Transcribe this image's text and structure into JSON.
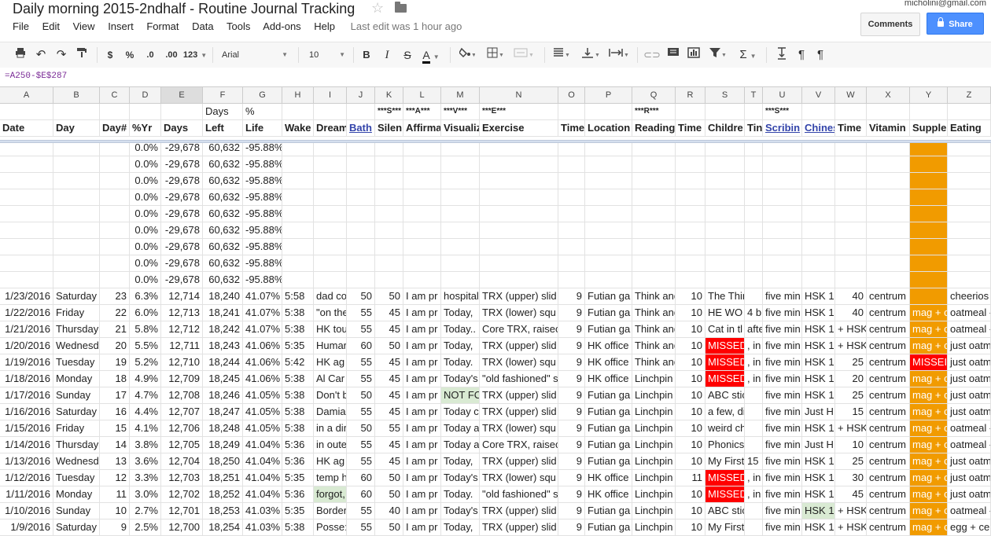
{
  "doc_title": "Daily morning 2015-2ndhalf - Routine Journal Tracking",
  "account_email": "micholini@gmail.com",
  "buttons": {
    "comments": "Comments",
    "share": "Share"
  },
  "menu": [
    "File",
    "Edit",
    "View",
    "Insert",
    "Format",
    "Data",
    "Tools",
    "Add-ons",
    "Help"
  ],
  "last_edit": "Last edit was 1 hour ago",
  "toolbar": {
    "currency": "$",
    "percent": "%",
    "dec_decrease": ".0",
    "dec_increase": ".00",
    "format_more": "123",
    "font": "Arial",
    "font_size": "10",
    "bold": "B",
    "italic": "I",
    "strike": "S",
    "text_color": "A",
    "sum": "Σ"
  },
  "formula": "=A250-$E$287",
  "columns": [
    "A",
    "B",
    "C",
    "D",
    "E",
    "F",
    "G",
    "H",
    "I",
    "J",
    "K",
    "L",
    "M",
    "N",
    "O",
    "P",
    "Q",
    "R",
    "S",
    "T",
    "U",
    "V",
    "W",
    "X",
    "Y",
    "Z"
  ],
  "selected_column": "E",
  "header_row1": {
    "F": "Days",
    "G": "%",
    "K": "***S***",
    "L": "***A***",
    "M": "***V***",
    "N": "***E***",
    "Q": "***R***",
    "U": "***S***"
  },
  "header_row2": {
    "A": "Date",
    "B": "Day",
    "C": "Day#",
    "D": "%Yr",
    "E": "Days",
    "F": "Left",
    "G": "Life",
    "H": "Wake",
    "I": "Dream",
    "J": "Bath",
    "K": "Silen",
    "L": "Affirma",
    "M": "Visualiz",
    "N": "Exercise",
    "O": "Time",
    "P": "Location",
    "Q": "Reading",
    "R": "Time",
    "S": "Childre",
    "T": "Tin",
    "U": "Scribin",
    "V": "Chines",
    "W": "Time",
    "X": "Vitamin",
    "Y": "Supple",
    "Z": "Eating"
  },
  "blank_rows": [
    {
      "D": "0.0%",
      "E": "-29,678",
      "F": "60,632",
      "G": "-95.88%"
    },
    {
      "D": "0.0%",
      "E": "-29,678",
      "F": "60,632",
      "G": "-95.88%"
    },
    {
      "D": "0.0%",
      "E": "-29,678",
      "F": "60,632",
      "G": "-95.88%"
    },
    {
      "D": "0.0%",
      "E": "-29,678",
      "F": "60,632",
      "G": "-95.88%"
    },
    {
      "D": "0.0%",
      "E": "-29,678",
      "F": "60,632",
      "G": "-95.88%"
    },
    {
      "D": "0.0%",
      "E": "-29,678",
      "F": "60,632",
      "G": "-95.88%"
    },
    {
      "D": "0.0%",
      "E": "-29,678",
      "F": "60,632",
      "G": "-95.88%"
    },
    {
      "D": "0.0%",
      "E": "-29,678",
      "F": "60,632",
      "G": "-95.88%"
    },
    {
      "D": "0.0%",
      "E": "-29,678",
      "F": "60,632",
      "G": "-95.88%"
    }
  ],
  "data_rows": [
    {
      "A": "1/23/2016",
      "B": "Saturday",
      "C": "23",
      "D": "6.3%",
      "E": "12,714",
      "F": "18,240",
      "G": "41.07%",
      "H": "5:58",
      "I": "dad co",
      "J": "50",
      "K": "50",
      "L": "I am pr",
      "M": "hospital",
      "N": "TRX (upper) slid",
      "O": "9",
      "P": "Futian ga",
      "Q": "Think and",
      "R": "10",
      "S": "The Thinks",
      "T": "",
      "U": "five min",
      "V": "HSK 1",
      "W": "40",
      "X": "centrum",
      "Y": "",
      "Z": "cheerios"
    },
    {
      "A": "1/22/2016",
      "B": "Friday",
      "C": "22",
      "D": "6.0%",
      "E": "12,713",
      "F": "18,241",
      "G": "41.07%",
      "H": "5:38",
      "I": "\"on the",
      "J": "55",
      "K": "45",
      "L": "I am pr",
      "M": "Today, ",
      "N": "TRX (lower) squ",
      "O": "9",
      "P": "Futian ga",
      "Q": "Think and",
      "R": "10",
      "S": "HE WO",
      "T": "4 b",
      "U": "five min",
      "V": "HSK 1",
      "W": "40",
      "X": "centrum",
      "Y": "mag + c",
      "Z": "oatmeal -"
    },
    {
      "A": "1/21/2016",
      "B": "Thursday",
      "C": "21",
      "D": "5.8%",
      "E": "12,712",
      "F": "18,242",
      "G": "41.07%",
      "H": "5:38",
      "I": "HK tou",
      "J": "55",
      "K": "45",
      "L": "I am pr",
      "M": "Today..",
      "N": "Core TRX, raisec",
      "O": "9",
      "P": "Futian ga",
      "Q": "Think and",
      "R": "10",
      "S": "Cat in tl",
      "T": "afte",
      "U": "five min",
      "V": "HSK 1",
      "W": "+ HSK",
      "X": "centrum",
      "Y": "mag + c",
      "Z": "oatmeal -"
    },
    {
      "A": "1/20/2016",
      "B": "Wednesd",
      "C": "20",
      "D": "5.5%",
      "E": "12,711",
      "F": "18,243",
      "G": "41.06%",
      "H": "5:35",
      "I": "Humar",
      "J": "60",
      "K": "50",
      "L": "I am pr",
      "M": "Today, ",
      "N": "TRX (upper) slid",
      "O": "9",
      "P": "HK office",
      "Q": "Think and",
      "R": "10",
      "S": "MISSED",
      "T": ", in",
      "U": "five min",
      "V": "HSK 1",
      "W": "+ HSK",
      "X": "centrum",
      "Y": "mag + c",
      "Z": "just oatm"
    },
    {
      "A": "1/19/2016",
      "B": "Tuesday",
      "C": "19",
      "D": "5.2%",
      "E": "12,710",
      "F": "18,244",
      "G": "41.06%",
      "H": "5:42",
      "I": "HK ag",
      "J": "55",
      "K": "45",
      "L": "I am pr",
      "M": "Today. ",
      "N": "TRX (lower) squ",
      "O": "9",
      "P": "HK office",
      "Q": "Think and",
      "R": "10",
      "S": "MISSED",
      "T": ", in",
      "U": "five min",
      "V": "HSK 1",
      "W": "25",
      "X": "centrum",
      "Y": "MISSEI",
      "Z": "just oatm"
    },
    {
      "A": "1/18/2016",
      "B": "Monday",
      "C": "18",
      "D": "4.9%",
      "E": "12,709",
      "F": "18,245",
      "G": "41.06%",
      "H": "5:38",
      "I": "Al Car",
      "J": "55",
      "K": "45",
      "L": "I am pr",
      "M": "Today's",
      "N": "\"old fashioned\" s",
      "O": "9",
      "P": "HK office",
      "Q": "Linchpin",
      "R": "10",
      "S": "MISSED",
      "T": ", in",
      "U": "five min",
      "V": "HSK 1",
      "W": "20",
      "X": "centrum",
      "Y": "mag + c",
      "Z": "just oatm"
    },
    {
      "A": "1/17/2016",
      "B": "Sunday",
      "C": "17",
      "D": "4.7%",
      "E": "12,708",
      "F": "18,246",
      "G": "41.05%",
      "H": "5:38",
      "I": "Don't b",
      "J": "50",
      "K": "45",
      "L": "I am pr",
      "M": "NOT FC",
      "N": "TRX (upper) slid",
      "O": "9",
      "P": "Futian ga",
      "Q": "Linchpin",
      "R": "10",
      "S": "ABC sticker",
      "T": "",
      "U": "five min",
      "V": "HSK 1",
      "W": "25",
      "X": "centrum",
      "Y": "mag + c",
      "Z": "just oatm"
    },
    {
      "A": "1/16/2016",
      "B": "Saturday",
      "C": "16",
      "D": "4.4%",
      "E": "12,707",
      "F": "18,247",
      "G": "41.05%",
      "H": "5:38",
      "I": "Damia",
      "J": "55",
      "K": "45",
      "L": "I am pr",
      "M": "Today c",
      "N": "TRX (upper) slid",
      "O": "9",
      "P": "Futian ga",
      "Q": "Linchpin",
      "R": "10",
      "S": "a few, dictio",
      "T": "",
      "U": "five min",
      "V": "Just H",
      "W": "15",
      "X": "centrum",
      "Y": "mag + c",
      "Z": "just oatm"
    },
    {
      "A": "1/15/2016",
      "B": "Friday",
      "C": "15",
      "D": "4.1%",
      "E": "12,706",
      "F": "18,248",
      "G": "41.05%",
      "H": "5:38",
      "I": "in a dir",
      "J": "50",
      "K": "55",
      "L": "I am pr",
      "M": "Today a",
      "N": "TRX (lower) squ",
      "O": "9",
      "P": "Futian ga",
      "Q": "Linchpin",
      "R": "10",
      "S": "weird chine",
      "T": "",
      "U": "five min",
      "V": "HSK 1",
      "W": "+ HSK",
      "X": "centrum",
      "Y": "mag + c",
      "Z": "oatmeal -"
    },
    {
      "A": "1/14/2016",
      "B": "Thursday",
      "C": "14",
      "D": "3.8%",
      "E": "12,705",
      "F": "18,249",
      "G": "41.04%",
      "H": "5:36",
      "I": "in oute",
      "J": "55",
      "K": "45",
      "L": "I am pr",
      "M": "Today a",
      "N": "Core TRX, raisec",
      "O": "9",
      "P": "Futian ga",
      "Q": "Linchpin",
      "R": "10",
      "S": "Phonics Dic",
      "T": "",
      "U": "five min",
      "V": "Just H",
      "W": "10",
      "X": "centrum",
      "Y": "mag + c",
      "Z": "oatmeal -"
    },
    {
      "A": "1/13/2016",
      "B": "Wednesd",
      "C": "13",
      "D": "3.6%",
      "E": "12,704",
      "F": "18,250",
      "G": "41.04%",
      "H": "5:36",
      "I": "HK ag",
      "J": "55",
      "K": "45",
      "L": "I am pr",
      "M": "Today, ",
      "N": "TRX (upper) slid",
      "O": "9",
      "P": "Futian ga",
      "Q": "Linchpin",
      "R": "10",
      "S": "My First",
      "T": "15",
      "U": "five min",
      "V": "HSK 1",
      "W": "25",
      "X": "centrum",
      "Y": "mag + c",
      "Z": "just oatm"
    },
    {
      "A": "1/12/2016",
      "B": "Tuesday",
      "C": "12",
      "D": "3.3%",
      "E": "12,703",
      "F": "18,251",
      "G": "41.04%",
      "H": "5:35",
      "I": "temp h",
      "J": "60",
      "K": "50",
      "L": "I am pr",
      "M": "Today's",
      "N": "TRX (lower) squ",
      "O": "9",
      "P": "HK office",
      "Q": "Linchpin",
      "R": "11",
      "S": "MISSED",
      "T": ", in",
      "U": "five min",
      "V": "HSK 1",
      "W": "30",
      "X": "centrum",
      "Y": "mag + c",
      "Z": "just oatm"
    },
    {
      "A": "1/11/2016",
      "B": "Monday",
      "C": "11",
      "D": "3.0%",
      "E": "12,702",
      "F": "18,252",
      "G": "41.04%",
      "H": "5:36",
      "I": "forgot,",
      "J": "60",
      "K": "50",
      "L": "I am pr",
      "M": "Today. ",
      "N": "\"old fashioned\" s",
      "O": "9",
      "P": "HK office",
      "Q": "Linchpin",
      "R": "10",
      "S": "MISSED",
      "T": ", in",
      "U": "five min",
      "V": "HSK 1",
      "W": "45",
      "X": "centrum",
      "Y": "mag + c",
      "Z": "just oatm"
    },
    {
      "A": "1/10/2016",
      "B": "Sunday",
      "C": "10",
      "D": "2.7%",
      "E": "12,701",
      "F": "18,253",
      "G": "41.03%",
      "H": "5:35",
      "I": "Border",
      "J": "55",
      "K": "40",
      "L": "I am pr",
      "M": "Today's",
      "N": "TRX (upper) slid",
      "O": "9",
      "P": "Futian ga",
      "Q": "Linchpin",
      "R": "10",
      "S": "ABC sticker",
      "T": "",
      "U": "five min",
      "V": "HSK 1",
      "W": "+ HSK",
      "X": "centrum",
      "Y": "mag + c",
      "Z": "oatmeal -"
    },
    {
      "A": "1/9/2016",
      "B": "Saturday",
      "C": "9",
      "D": "2.5%",
      "E": "12,700",
      "F": "18,254",
      "G": "41.03%",
      "H": "5:38",
      "I": "Posse:",
      "J": "55",
      "K": "50",
      "L": "I am pr",
      "M": "Today, ",
      "N": "TRX (upper) slid",
      "O": "9",
      "P": "Futian ga",
      "Q": "Linchpin",
      "R": "10",
      "S": "My First dic",
      "T": "",
      "U": "five min",
      "V": "HSK 1",
      "W": "+ HSK",
      "X": "centrum",
      "Y": "mag + c",
      "Z": "egg + cer"
    }
  ],
  "highlight_colors": {
    "missed": "#ff0000",
    "supplement": "#f19b00",
    "done": "#d9ead3"
  }
}
